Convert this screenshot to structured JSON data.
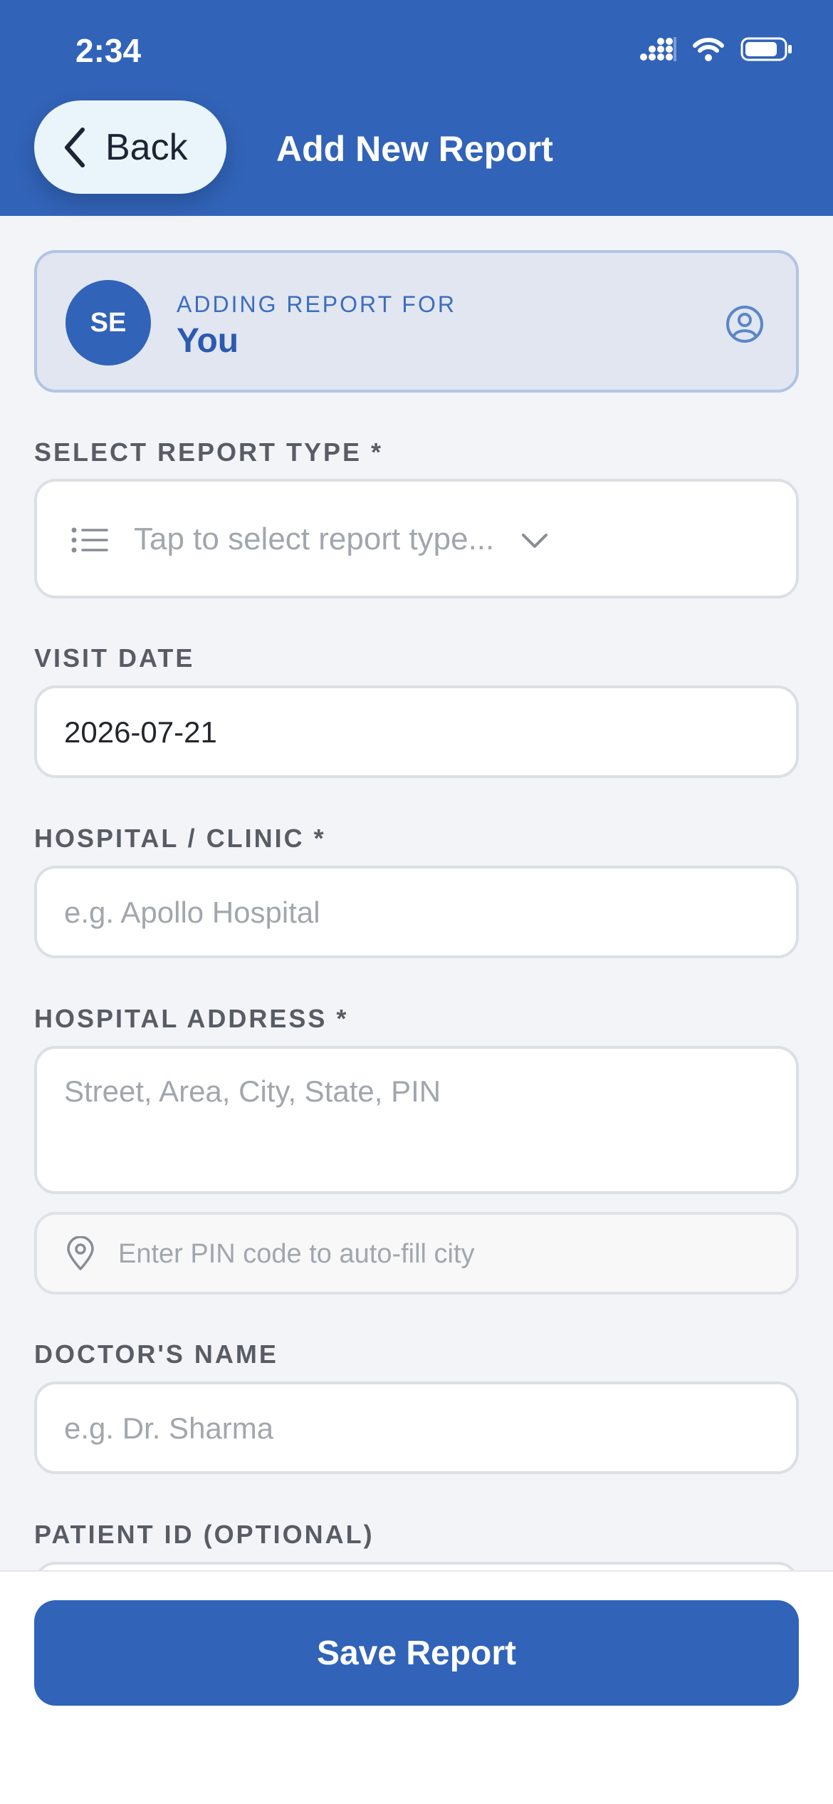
{
  "status_bar": {
    "time": "2:34"
  },
  "header": {
    "back_label": "Back",
    "title": "Add New Report"
  },
  "profile_card": {
    "initials": "SE",
    "caption": "ADDING REPORT FOR",
    "name": "You"
  },
  "form": {
    "report_type": {
      "label": "SELECT REPORT TYPE *",
      "placeholder": "Tap to select report type..."
    },
    "visit_date": {
      "label": "VISIT DATE",
      "value": "2026-07-21"
    },
    "hospital": {
      "label": "HOSPITAL / CLINIC *",
      "placeholder": "e.g. Apollo Hospital"
    },
    "address": {
      "label": "HOSPITAL ADDRESS *",
      "placeholder": "Street, Area, City, State, PIN"
    },
    "pin": {
      "placeholder": "Enter PIN code to auto-fill city"
    },
    "doctor": {
      "label": "DOCTOR'S NAME",
      "placeholder": "e.g. Dr. Sharma"
    },
    "patient_id": {
      "label": "PATIENT ID (OPTIONAL)"
    }
  },
  "footer": {
    "save_label": "Save Report"
  },
  "colors": {
    "primary": "#3163b8",
    "background": "#f2f4f8",
    "card": "#e1e6f1"
  }
}
